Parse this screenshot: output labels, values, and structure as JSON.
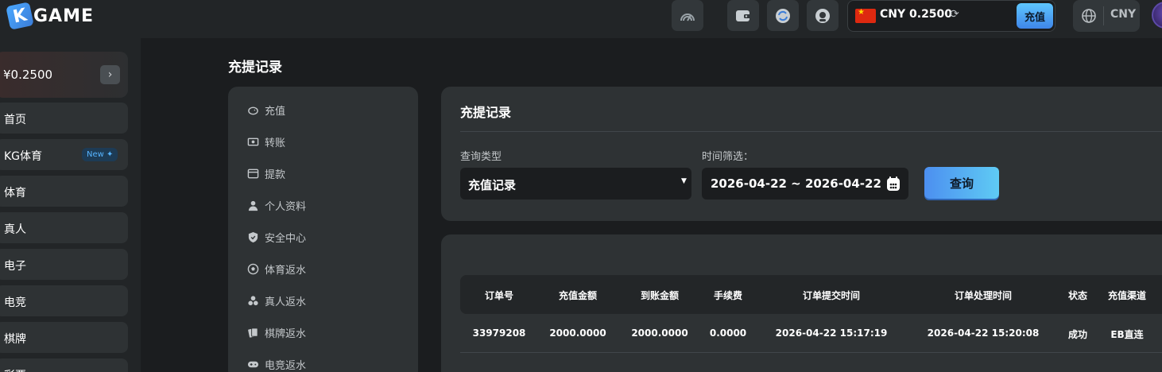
{
  "app": {
    "logo_text": "GAME",
    "logo_letter": "K"
  },
  "topbar": {
    "balance_text": "CNY 0.2500",
    "deposit_label": "充值",
    "currency_label": "CNY",
    "icons": [
      "speed-icon",
      "wallet-icon",
      "transfer-icon",
      "service-icon",
      "refresh-icon",
      "globe-icon"
    ]
  },
  "sidebar": {
    "wallet_amount": "¥0.2500",
    "items": [
      {
        "label": "首页"
      },
      {
        "label": "KG体育",
        "badge": "New ✦"
      },
      {
        "label": "体育"
      },
      {
        "label": "真人"
      },
      {
        "label": "电子"
      },
      {
        "label": "电竞"
      },
      {
        "label": "棋牌"
      },
      {
        "label": "彩票"
      }
    ]
  },
  "page": {
    "title": "充提记录"
  },
  "account_menu": {
    "items": [
      {
        "label": "充值",
        "icon": "piggy-bank-icon"
      },
      {
        "label": "转账",
        "icon": "transfer-cash-icon"
      },
      {
        "label": "提款",
        "icon": "withdraw-icon"
      },
      {
        "label": "个人资料",
        "icon": "user-icon"
      },
      {
        "label": "安全中心",
        "icon": "shield-icon"
      },
      {
        "label": "体育返水",
        "icon": "soccer-ball-icon"
      },
      {
        "label": "真人返水",
        "icon": "chips-icon"
      },
      {
        "label": "棋牌返水",
        "icon": "cards-icon"
      },
      {
        "label": "电竞返水",
        "icon": "gamepad-icon"
      }
    ]
  },
  "filter": {
    "title": "充提记录",
    "type_label": "查询类型",
    "type_value": "充值记录",
    "time_label": "时间筛选：",
    "date_range": "2026-04-22 ~ 2026-04-22",
    "query_label": "查询"
  },
  "table": {
    "columns": [
      "订单号",
      "充值金额",
      "到账金额",
      "手续费",
      "订单提交时间",
      "订单处理时间",
      "状态",
      "充值渠道"
    ],
    "rows": [
      [
        "33979208",
        "2000.0000",
        "2000.0000",
        "0.0000",
        "2026-04-22 15:17:19",
        "2026-04-22 15:20:08",
        "成功",
        "EB直连"
      ]
    ]
  }
}
